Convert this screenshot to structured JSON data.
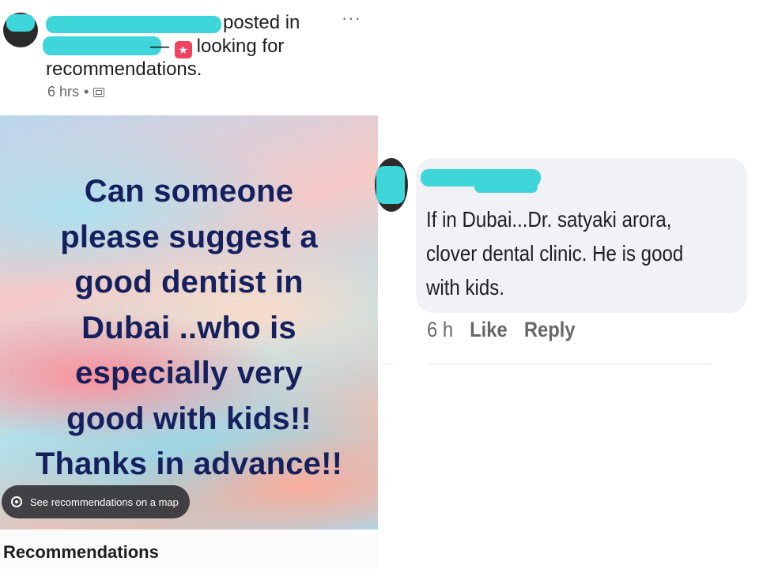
{
  "post": {
    "header_line1": "posted in",
    "header_line2": "looking for",
    "header_line3": "recommendations.",
    "star_badge_icon": "star-badge-icon",
    "timestamp": "6 hrs",
    "separator": "•",
    "audience_icon": "group-icon",
    "more_icon": "···",
    "banner": {
      "text_lines": [
        "Can someone",
        "please suggest a",
        "good dentist in",
        "Dubai ..who is",
        "especially very",
        "good with kids!!",
        "Thanks in advance!!"
      ],
      "text_color": "#15205e",
      "map_chip_label": "See recommendations on a map"
    },
    "recommendations_title": "Recommendations"
  },
  "comment": {
    "lines": [
      "If in Dubai...Dr. satyaki arora,",
      "clover dental clinic. He is good",
      "with kids."
    ],
    "time": "6 h",
    "like_label": "Like",
    "reply_label": "Reply"
  },
  "colors": {
    "redaction": "#3fd6d9",
    "badge": "#f3425f",
    "bubble": "#f0f2f5",
    "secondary_text": "#65676b"
  }
}
